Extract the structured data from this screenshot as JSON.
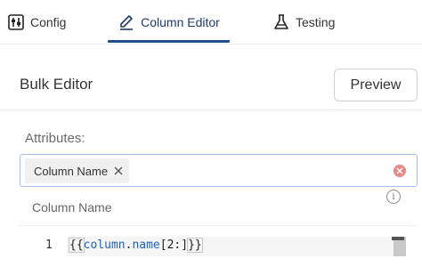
{
  "tabs": {
    "config": {
      "label": "Config",
      "icon": "sliders-icon"
    },
    "column_editor": {
      "label": "Column Editor",
      "icon": "pencil-icon"
    },
    "testing": {
      "label": "Testing",
      "icon": "flask-icon"
    },
    "active": "column_editor"
  },
  "header": {
    "title": "Bulk Editor",
    "preview_label": "Preview"
  },
  "attributes": {
    "label": "Attributes:",
    "selected": [
      {
        "label": "Column Name"
      }
    ],
    "focus_color": "#9fc3e6",
    "clear_color": "#e58a8a"
  },
  "column_section": {
    "label": "Column Name"
  },
  "editor": {
    "line_number": "1",
    "code_open": "{{",
    "code_ident1": "column",
    "code_dot": ".",
    "code_ident2": "name",
    "code_rest": "[2:]",
    "code_close": "}}"
  },
  "accent_color": "#1f4f86"
}
